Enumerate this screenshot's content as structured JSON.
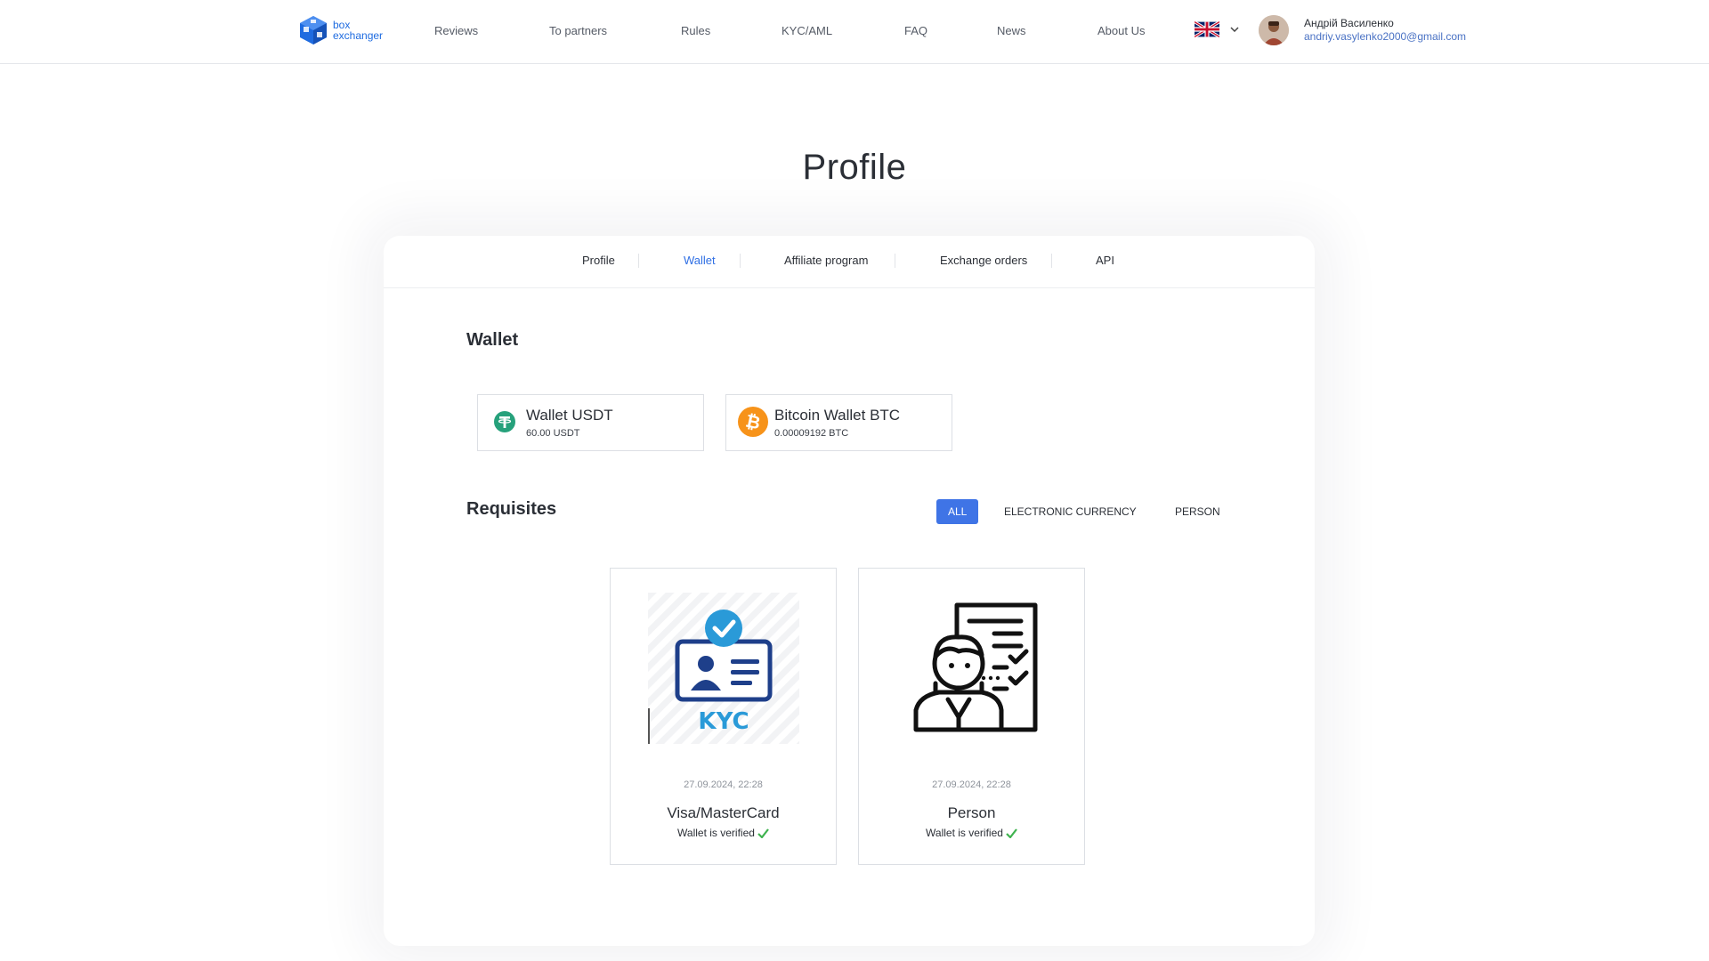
{
  "header": {
    "logo": {
      "line1": "box",
      "line2": "exchanger"
    },
    "nav": [
      {
        "label": "Reviews"
      },
      {
        "label": "To partners"
      },
      {
        "label": "Rules"
      },
      {
        "label": "KYC/AML"
      },
      {
        "label": "FAQ"
      },
      {
        "label": "News"
      },
      {
        "label": "About Us"
      }
    ],
    "language": {
      "flag": "uk-flag-icon"
    },
    "user": {
      "name": "Андрій Василенко",
      "email": "andriy.vasylenko2000@gmail.com"
    }
  },
  "page": {
    "title": "Profile"
  },
  "tabs": [
    {
      "label": "Profile"
    },
    {
      "label": "Wallet",
      "active": true
    },
    {
      "label": "Affiliate program"
    },
    {
      "label": "Exchange orders"
    },
    {
      "label": "API"
    }
  ],
  "wallet": {
    "title": "Wallet",
    "items": [
      {
        "name": "Wallet USDT",
        "balance": "60.00 USDT",
        "icon": "tether-icon",
        "color": "#26a17b"
      },
      {
        "name": "Bitcoin Wallet BTC",
        "balance": "0.00009192 BTC",
        "icon": "bitcoin-icon",
        "color": "#f7931a"
      }
    ]
  },
  "requisites": {
    "title": "Requisites",
    "filters": [
      {
        "label": "ALL",
        "active": true
      },
      {
        "label": "ELECTRONIC CURRENCY"
      },
      {
        "label": "PERSON"
      }
    ],
    "cards": [
      {
        "date": "27.09.2024, 22:28",
        "name": "Visa/MasterCard",
        "status": "Wallet is verified",
        "image": "kyc-id-card-icon",
        "image_text": "KYC"
      },
      {
        "date": "27.09.2024, 22:28",
        "name": "Person",
        "status": "Wallet is verified",
        "image": "person-document-icon"
      }
    ]
  },
  "colors": {
    "accent": "#2f6fe4",
    "verified": "#3fb34f",
    "kyc_blue": "#1e3f8a",
    "kyc_light": "#2a9ad8"
  }
}
